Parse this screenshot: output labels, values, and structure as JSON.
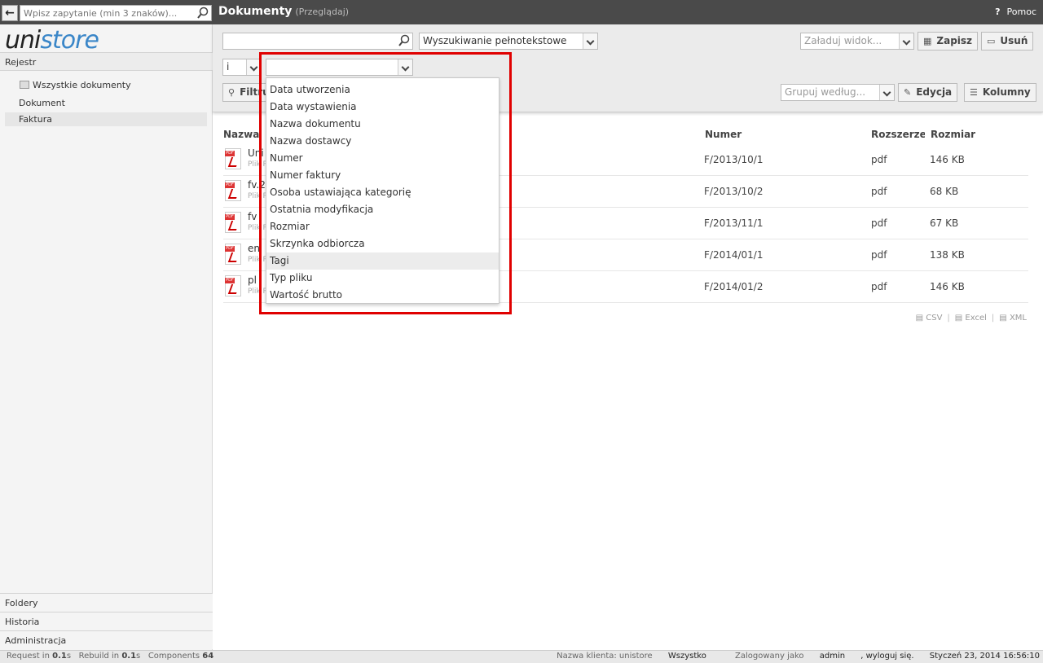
{
  "topbar": {
    "search_placeholder": "Wpisz zapytanie (min 3 znaków)...",
    "title": "Dokumenty",
    "subtitle": "(Przeglądaj)",
    "help_label": "Pomoc"
  },
  "sidebar": {
    "logo_part1": "uni",
    "logo_part2": "store",
    "section_title": "Rejestr",
    "tree": [
      "Wszystkie dokumenty",
      "Dokument",
      "Faktura"
    ],
    "bottom": [
      "Foldery",
      "Historia",
      "Administracja"
    ]
  },
  "toolbar": {
    "search_value": "",
    "search_mode": "Wyszukiwanie pełnotekstowe",
    "view_placeholder": "Załaduj widok...",
    "save_label": "Zapisz",
    "delete_label": "Usuń",
    "operator_value": "i",
    "field_value": "",
    "filter_label": "Filtruj",
    "group_placeholder": "Grupuj według...",
    "edit_label": "Edycja",
    "columns_label": "Kolumny"
  },
  "table": {
    "headers": [
      "Nazwa",
      "Numer",
      "Rozszerzenie",
      "Rozmiar"
    ],
    "rows": [
      {
        "name": "Uni",
        "sub": "Plik P",
        "number": "F/2013/10/1",
        "ext": "pdf",
        "size": "146 KB"
      },
      {
        "name": "fv.2",
        "sub": "Plik P",
        "number": "F/2013/10/2",
        "ext": "pdf",
        "size": "68 KB"
      },
      {
        "name": "fv",
        "sub": "Plik P",
        "number": "F/2013/11/1",
        "ext": "pdf",
        "size": "67 KB"
      },
      {
        "name": "en",
        "sub": "Plik P",
        "number": "F/2014/01/1",
        "ext": "pdf",
        "size": "138 KB"
      },
      {
        "name": "pl",
        "sub": "Plik P",
        "number": "F/2014/01/2",
        "ext": "pdf",
        "size": "146 KB"
      }
    ],
    "exports": [
      "CSV",
      "Excel",
      "XML"
    ]
  },
  "dropdown": {
    "options": [
      "Data utworzenia",
      "Data wystawienia",
      "Nazwa dokumentu",
      "Nazwa dostawcy",
      "Numer",
      "Numer faktury",
      "Osoba ustawiająca kategorię",
      "Ostatnia modyfikacja",
      "Rozmiar",
      "Skrzynka odbiorcza",
      "Tagi",
      "Typ pliku",
      "Wartość brutto"
    ],
    "hovered": "Tagi"
  },
  "statusbar": {
    "req_label": "Request in",
    "req_value": "0.1",
    "req_unit": "s",
    "rebuild_label": "Rebuild in",
    "rebuild_value": "0.1",
    "rebuild_unit": "s",
    "components_label": "Components",
    "components_value": "64",
    "client": "Nazwa klienta: unistore",
    "scope": "Wszystko",
    "logged_prefix": "Zalogowany jako",
    "user": "admin",
    "logout": ", wyloguj się.",
    "datetime": "Styczeń 23, 2014 16:56:10"
  },
  "colors": {
    "accent": "#3a86c8",
    "topbar": "#4a4a4a",
    "highlight": "#e00000"
  }
}
